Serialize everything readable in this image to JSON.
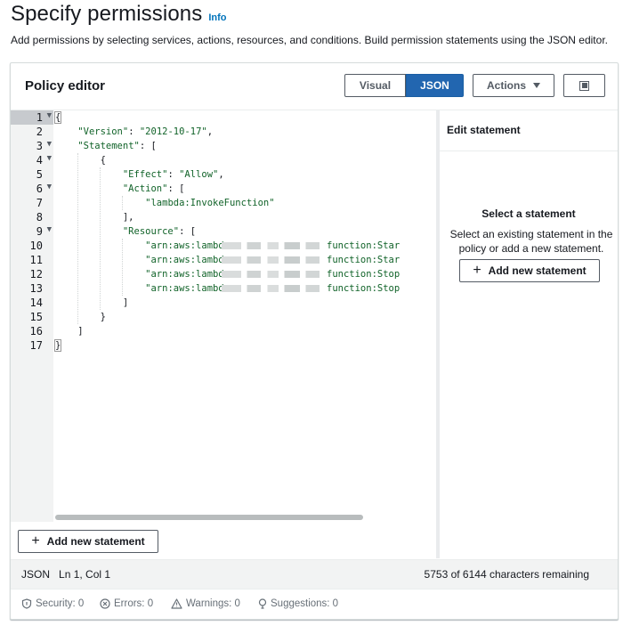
{
  "page": {
    "title": "Specify permissions",
    "info_link": "Info",
    "description": "Add permissions by selecting services, actions, resources, and conditions. Build permission statements using the JSON editor."
  },
  "policy_editor": {
    "title": "Policy editor",
    "mode_visual": "Visual",
    "mode_json": "JSON",
    "active_mode": "JSON",
    "actions_label": "Actions",
    "panel_toggle_icon": "split-panel-icon"
  },
  "editor": {
    "line_numbers": [
      "1",
      "2",
      "3",
      "4",
      "5",
      "6",
      "7",
      "8",
      "9",
      "10",
      "11",
      "12",
      "13",
      "14",
      "15",
      "16",
      "17"
    ],
    "lines": {
      "l1": "{",
      "l2_key": "\"Version\"",
      "l2_val": "\"2012-10-17\"",
      "l3_key": "\"Statement\"",
      "l3_rest": ": [",
      "l4": "{",
      "l5_key": "\"Effect\"",
      "l5_val": "\"Allow\"",
      "l6_key": "\"Action\"",
      "l6_rest": ": [",
      "l7_val": "\"lambda:InvokeFunction\"",
      "l8": "],",
      "l9_key": "\"Resource\"",
      "l9_rest": ": [",
      "r1_a": "\"arn:aws:lambda:",
      "r1_b": "function:Star",
      "r2_a": "\"arn:aws:lambda:",
      "r2_b": "function:Star",
      "r3_a": "\"arn:aws:lambda:",
      "r3_b": "function:Stop",
      "r4_a": "\"arn:aws:lambda:",
      "r4_b": "function:Stop",
      "l14": "]",
      "l15": "}",
      "l16": "]",
      "l17": "}"
    },
    "add_statement_label": "Add new statement"
  },
  "side_panel": {
    "title": "Edit statement",
    "select_title": "Select a statement",
    "select_desc": "Select an existing statement in the policy or add a new statement.",
    "add_statement_label": "Add new statement"
  },
  "status_bar": {
    "mode": "JSON",
    "position": "Ln 1, Col 1",
    "chars_remaining": "5753 of 6144 characters remaining"
  },
  "validation": {
    "security": "Security: 0",
    "errors": "Errors: 0",
    "warnings": "Warnings: 0",
    "suggestions": "Suggestions: 0"
  },
  "colors": {
    "accent": "#2266b0",
    "info_link": "#0073bb",
    "string_green": "#116329"
  }
}
